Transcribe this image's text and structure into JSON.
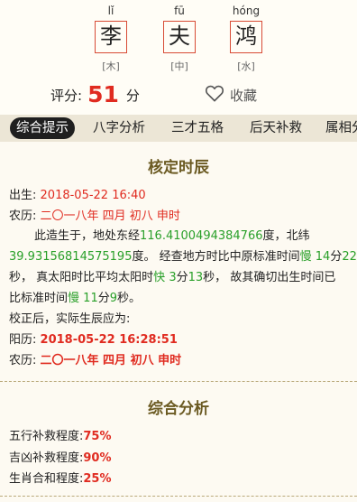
{
  "name": {
    "chars": [
      {
        "pinyin": "lǐ",
        "char": "李",
        "wuxing": "[木]"
      },
      {
        "pinyin": "fū",
        "char": "夫",
        "wuxing": "[中]"
      },
      {
        "pinyin": "hóng",
        "char": "鸿",
        "wuxing": "[水]"
      }
    ]
  },
  "score": {
    "label": "评分:",
    "value": "51",
    "unit": "分"
  },
  "favorite": {
    "label": "收藏"
  },
  "tabs": [
    "综合提示",
    "八字分析",
    "三才五格",
    "后天补救",
    "属相分"
  ],
  "birth_section": {
    "title": "核定时辰",
    "birth_label": "出生:",
    "birth_value": "2018-05-22 16:40",
    "lunar_label": "农历:",
    "lunar_value": "二〇一八年 四月 初八 申时",
    "desc_1": "此造生于，地处东经",
    "longitude": "116.4100494384766",
    "desc_2": "度，北纬",
    "latitude": "39.93156814575195",
    "desc_3": "度。 经查地方时比中原标准时间",
    "slow_1": "慢",
    "min_1": "14",
    "unit_min_1": "分",
    "sec_1": "22",
    "unit_sec_1": "秒，",
    "desc_4": "真太阳时比平均太阳时",
    "fast": "快",
    "min_2": "3",
    "unit_min_2": "分",
    "sec_2": "13",
    "unit_sec_2": "秒，",
    "desc_5": "故其确切出生时间已",
    "desc_6": "比标准时间",
    "slow_2": "慢",
    "min_3": "11",
    "unit_min_3": "分",
    "sec_3": "9",
    "unit_sec_3": "秒。",
    "corrected_intro": "校正后，实际生辰应为:",
    "solar_label": "阳历:",
    "solar_value": "2018-05-22 16:28:51",
    "lunar2_label": "农历:",
    "lunar2_value": "二〇一八年 四月 初八 申时"
  },
  "analysis_section": {
    "title": "综合分析",
    "items": [
      {
        "label": "五行补救程度:",
        "value": "75%"
      },
      {
        "label": "吉凶补救程度:",
        "value": "90%"
      },
      {
        "label": "生肖合和程度:",
        "value": "25%"
      }
    ]
  },
  "colors": {
    "accent_red": "#e02b20",
    "value_green": "#2aa02a",
    "title_brown": "#6b5a22",
    "tab_bar": "#ece6d6"
  }
}
